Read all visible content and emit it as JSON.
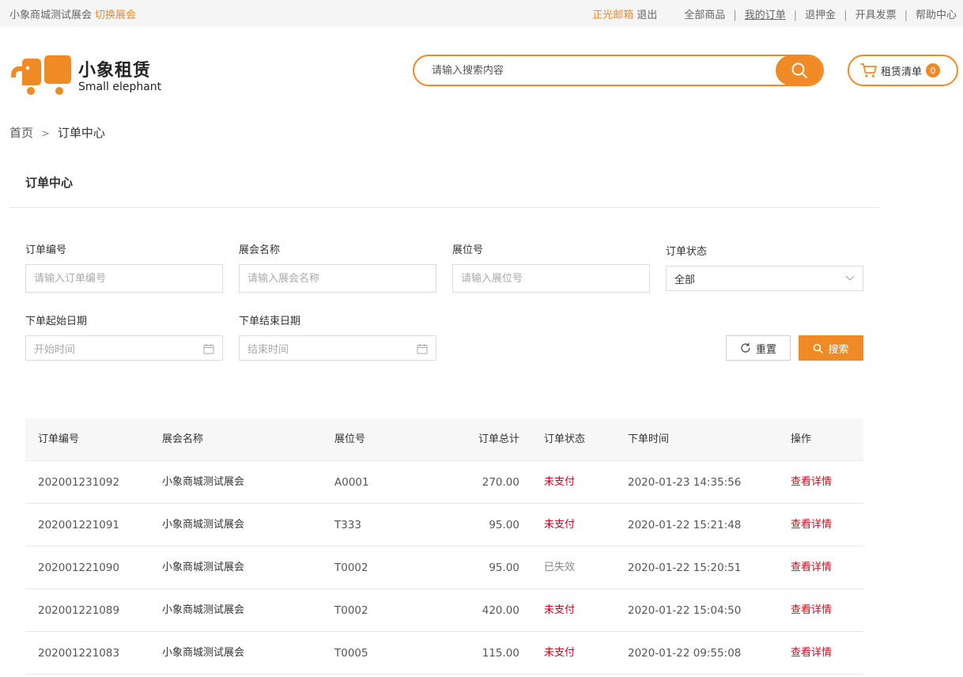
{
  "topbar": {
    "expo_name": "小象商城测试展会",
    "switch_label": "切换展会",
    "username": "正光邮箱",
    "logout_label": "退出",
    "nav": [
      "全部商品",
      "我的订单",
      "退押金",
      "开具发票",
      "帮助中心"
    ]
  },
  "logo": {
    "cn": "小象租赁",
    "en": "Small elephant"
  },
  "search": {
    "placeholder": "请输入搜索内容"
  },
  "cart": {
    "label": "租赁清单",
    "count": "0"
  },
  "breadcrumb": {
    "home": "首页",
    "separator": ">",
    "current": "订单中心"
  },
  "section_title": "订单中心",
  "filters": {
    "order_no": {
      "label": "订单编号",
      "placeholder": "请输入订单编号"
    },
    "expo_name": {
      "label": "展会名称",
      "placeholder": "请输入展会名称"
    },
    "booth_no": {
      "label": "展位号",
      "placeholder": "请输入展位号"
    },
    "status": {
      "label": "订单状态",
      "value": "全部"
    },
    "start_date": {
      "label": "下单起始日期",
      "placeholder": "开始时间"
    },
    "end_date": {
      "label": "下单结束日期",
      "placeholder": "结束时间"
    },
    "reset_label": "重置",
    "search_label": "搜索"
  },
  "table": {
    "headers": [
      "订单编号",
      "展会名称",
      "展位号",
      "订单总计",
      "订单状态",
      "下单时间",
      "操作"
    ],
    "rows": [
      {
        "order_no": "202001231092",
        "expo": "小象商城测试展会",
        "booth": "A0001",
        "total": "270.00",
        "status": "未支付",
        "status_type": "unpaid",
        "time": "2020-01-23 14:35:56",
        "action": "查看详情"
      },
      {
        "order_no": "202001221091",
        "expo": "小象商城测试展会",
        "booth": "T333",
        "total": "95.00",
        "status": "未支付",
        "status_type": "unpaid",
        "time": "2020-01-22 15:21:48",
        "action": "查看详情"
      },
      {
        "order_no": "202001221090",
        "expo": "小象商城测试展会",
        "booth": "T0002",
        "total": "95.00",
        "status": "已失效",
        "status_type": "expired",
        "time": "2020-01-22 15:20:51",
        "action": "查看详情"
      },
      {
        "order_no": "202001221089",
        "expo": "小象商城测试展会",
        "booth": "T0002",
        "total": "420.00",
        "status": "未支付",
        "status_type": "unpaid",
        "time": "2020-01-22 15:04:50",
        "action": "查看详情"
      },
      {
        "order_no": "202001221083",
        "expo": "小象商城测试展会",
        "booth": "T0005",
        "total": "115.00",
        "status": "未支付",
        "status_type": "unpaid",
        "time": "2020-01-22 09:55:08",
        "action": "查看详情"
      }
    ]
  },
  "colors": {
    "accent": "#f08a24",
    "danger": "#d0021b",
    "muted": "#888888"
  }
}
